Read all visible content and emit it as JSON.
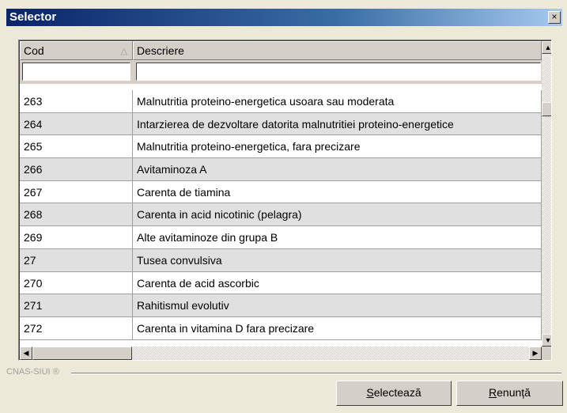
{
  "window": {
    "title": "Selector",
    "close_glyph": "×"
  },
  "grid": {
    "columns": [
      {
        "label": "Cod",
        "sort": "ascending"
      },
      {
        "label": "Descriere"
      }
    ],
    "filters": {
      "cod": "",
      "descriere": ""
    },
    "rows": [
      {
        "cod": "263",
        "descriere": "Malnutritia proteino-energetica usoara sau moderata"
      },
      {
        "cod": "264",
        "descriere": "Intarzierea de dezvoltare datorita malnutritiei proteino-energetice"
      },
      {
        "cod": "265",
        "descriere": "Malnutritia proteino-energetica, fara precizare"
      },
      {
        "cod": "266",
        "descriere": "Avitaminoza A"
      },
      {
        "cod": "267",
        "descriere": "Carenta de tiamina"
      },
      {
        "cod": "268",
        "descriere": "Carenta in acid nicotinic (pelagra)"
      },
      {
        "cod": "269",
        "descriere": "Alte avitaminoze din grupa B"
      },
      {
        "cod": "27",
        "descriere": "Tusea convulsiva"
      },
      {
        "cod": "270",
        "descriere": "Carenta de acid ascorbic"
      },
      {
        "cod": "271",
        "descriere": "Rahitismul evolutiv"
      },
      {
        "cod": "272",
        "descriere": "Carenta in vitamina D fara precizare"
      }
    ]
  },
  "footer": {
    "brand": "CNAS-SIUI ®",
    "select_button": {
      "mnemonic": "S",
      "rest": "electează"
    },
    "cancel_button": {
      "mnemonic": "R",
      "rest": "enunță"
    }
  }
}
